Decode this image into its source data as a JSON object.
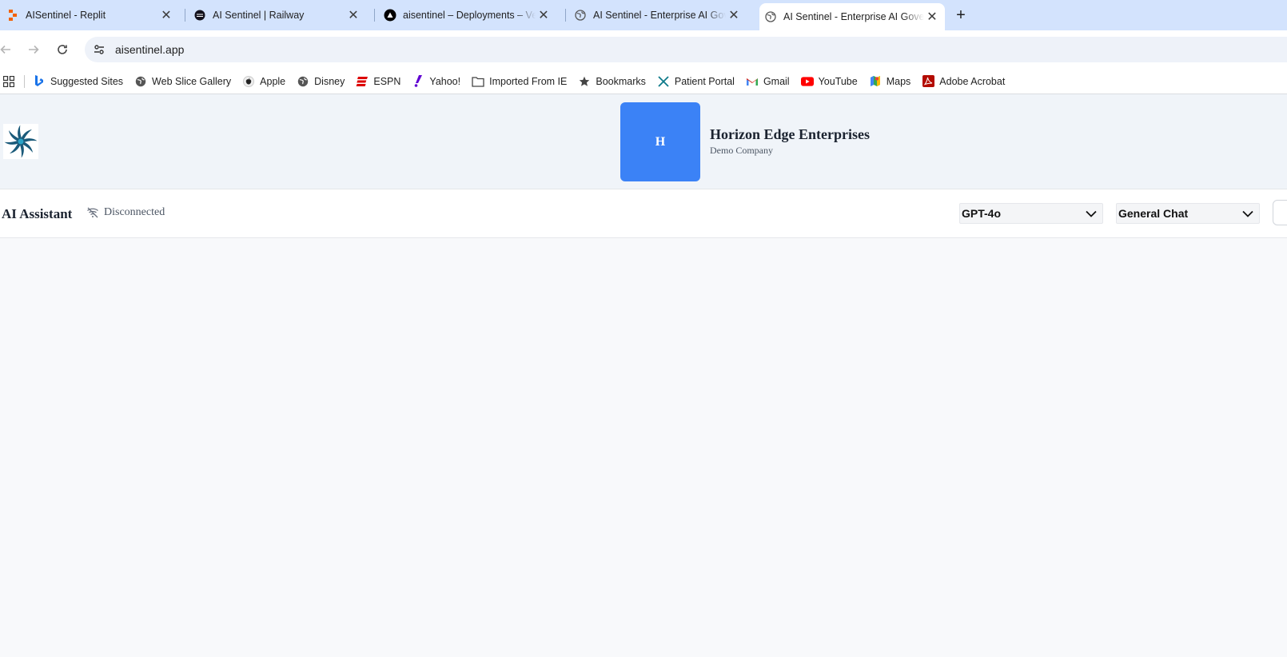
{
  "browser": {
    "tabs": [
      {
        "title": "AISentinel - Replit",
        "favicon": "replit-icon"
      },
      {
        "title": "AI Sentinel | Railway",
        "favicon": "railway-icon"
      },
      {
        "title": "aisentinel – Deployments – Vercel",
        "favicon": "vercel-icon"
      },
      {
        "title": "AI Sentinel - Enterprise AI Governance",
        "favicon": "globe-icon"
      },
      {
        "title": "AI Sentinel - Enterprise AI Governance",
        "favicon": "globe-icon",
        "active": true
      }
    ],
    "url": "aisentinel.app",
    "bookmarks": [
      {
        "label": "Suggested Sites",
        "icon": "bing-icon"
      },
      {
        "label": "Web Slice Gallery",
        "icon": "globe-icon"
      },
      {
        "label": "Apple",
        "icon": "apple-icon"
      },
      {
        "label": "Disney",
        "icon": "globe-icon"
      },
      {
        "label": "ESPN",
        "icon": "espn-icon"
      },
      {
        "label": "Yahoo!",
        "icon": "yahoo-icon"
      },
      {
        "label": "Imported From IE",
        "icon": "folder-icon"
      },
      {
        "label": "Bookmarks",
        "icon": "star-icon"
      },
      {
        "label": "Patient Portal",
        "icon": "x-logo-icon"
      },
      {
        "label": "Gmail",
        "icon": "gmail-icon"
      },
      {
        "label": "YouTube",
        "icon": "youtube-icon"
      },
      {
        "label": "Maps",
        "icon": "maps-icon"
      },
      {
        "label": "Adobe Acrobat",
        "icon": "acrobat-icon"
      }
    ]
  },
  "header": {
    "company_initial": "H",
    "company_name": "Horizon Edge Enterprises",
    "company_subtitle": "Demo Company"
  },
  "assistant": {
    "title": "AI Assistant",
    "status": "Disconnected",
    "model_select": "GPT-4o",
    "mode_select": "General Chat"
  },
  "colors": {
    "tabstrip": "#d3e3fd",
    "avatar": "#3b82f6",
    "header_bg": "#f0f4f9"
  }
}
